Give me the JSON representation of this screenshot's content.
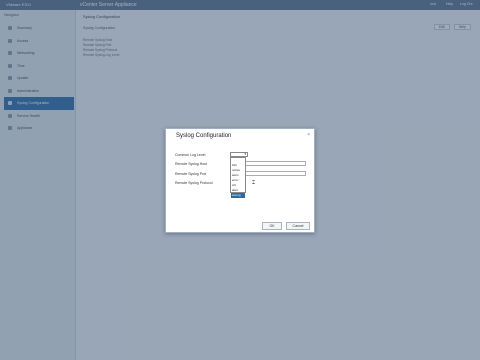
{
  "header": {
    "brand": "VMware ESXi",
    "title": "vCenter Server Appliance",
    "links": [
      "root",
      "Help",
      "Log Out"
    ]
  },
  "sidebar": {
    "heading": "Navigator",
    "items": [
      {
        "label": "Summary"
      },
      {
        "label": "Access"
      },
      {
        "label": "Networking"
      },
      {
        "label": "Time"
      },
      {
        "label": "Update"
      },
      {
        "label": "Administration"
      },
      {
        "label": "Syslog Configuration",
        "active": true
      },
      {
        "label": "Service Health"
      },
      {
        "label": "Appliance"
      }
    ]
  },
  "main": {
    "title": "Syslog Configuration",
    "section": "Syslog Configuration",
    "rows": [
      "Remote Syslog Host",
      "Remote Syslog Port",
      "Remote Syslog Protocol",
      "Remote Syslog Log Level"
    ],
    "buttons": [
      "Edit",
      "Help"
    ]
  },
  "dialog": {
    "title": "Syslog Configuration",
    "close": "×",
    "labels": [
      "Common Log Level",
      "Remote Syslog Host",
      "Remote Syslog Port",
      "Remote Syslog Protocol"
    ],
    "select_value": "▾",
    "options": [
      "",
      "info",
      "notice",
      "warn",
      "error",
      "crit",
      "alert",
      "emerg"
    ],
    "selected_index": 7,
    "ok": "OK",
    "cancel": "Cancel"
  }
}
